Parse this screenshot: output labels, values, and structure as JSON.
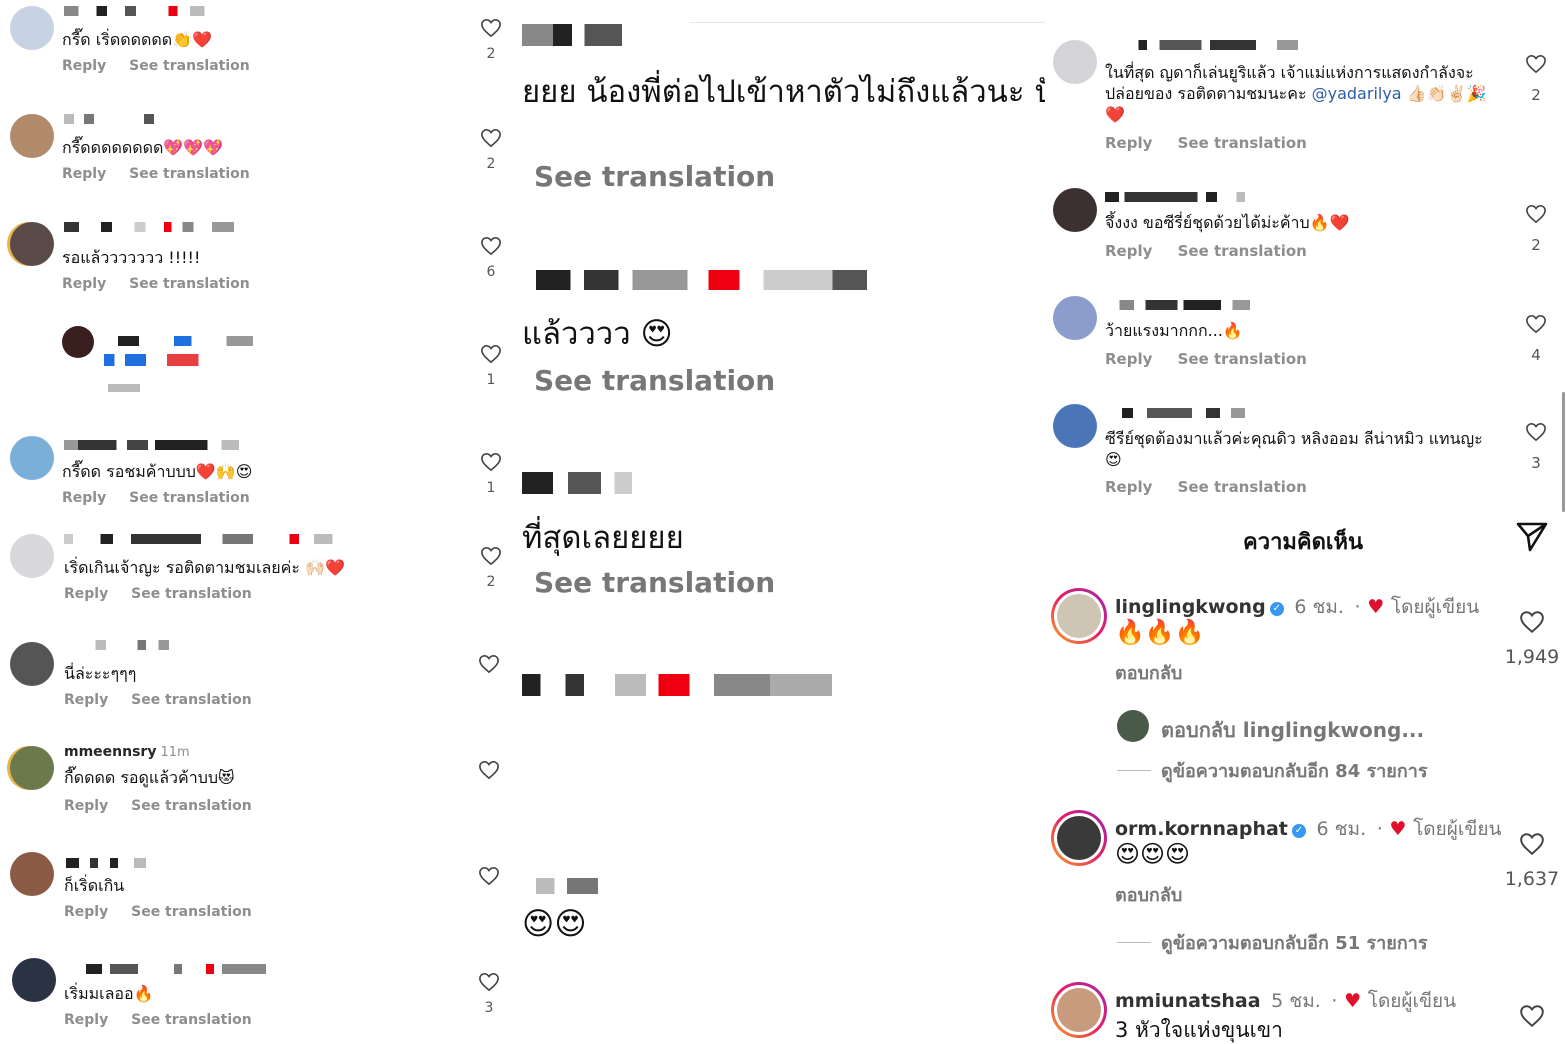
{
  "col1": {
    "comments": [
      {
        "text": "กรี๊ด เริ่ดดดดดด👏❤️",
        "reply": "Reply",
        "translate": "See translation",
        "likes": "2"
      },
      {
        "text": "กรี๊ดดดดดดดด💖💖💖",
        "reply": "Reply",
        "translate": "See translation",
        "likes": "2"
      },
      {
        "text": "รอแล้ววววววว !!!!!",
        "reply": "Reply",
        "translate": "See translation",
        "likes": "6"
      },
      {
        "text": "",
        "reply": "",
        "translate": "",
        "likes": "1"
      },
      {
        "text": "กรี๊ดด รอชมค้าบบบ❤️🙌😍",
        "reply": "Reply",
        "translate": "See translation",
        "likes": "1"
      },
      {
        "text": "เริ่ดเกินเจ้าญะ รอติดตามชมเลยค่ะ 🙌🏻❤️",
        "reply": "Reply",
        "translate": "See translation",
        "likes": "2"
      },
      {
        "text": "นี่ล่ะะะๆๆๆ",
        "reply": "Reply",
        "translate": "See translation",
        "likes": ""
      },
      {
        "username": "mmeennsry",
        "time": "11m",
        "text": "กี๊ดดดด รอดูแล้วค้าบบ😻",
        "reply": "Reply",
        "translate": "See translation",
        "likes": ""
      },
      {
        "text": "ก็เริ่ดเกิน",
        "reply": "Reply",
        "translate": "See translation",
        "likes": ""
      },
      {
        "text": "เริ่มมเลออ🔥",
        "reply": "Reply",
        "translate": "See translation",
        "likes": "3"
      }
    ]
  },
  "col2": {
    "lines": [
      "ยยย น้องพี่ต่อไปเข้าหาตัวไม่ถึงแล้วนะ ปั",
      "แล้วววว 😍",
      "ที่สุดเลยยยย",
      "😍😍"
    ],
    "translate": "See translation"
  },
  "col3": {
    "comments": [
      {
        "text": "ในที่สุด ญดาก็เล่นยูริแล้ว เจ้าแม่แห่งการแสดงกำลังจะปล่อยของ รอติดตามชมนะคะ ",
        "mention": "@yadarilya",
        "tail": " 👍🏻👏🏻✌🏻🎉❤️",
        "reply": "Reply",
        "translate": "See translation",
        "likes": "2"
      },
      {
        "text": "จึ้งงง ขอซีรี่ย์ชุดด้วยได้ม่ะค้าบ🔥❤️",
        "reply": "Reply",
        "translate": "See translation",
        "likes": "2"
      },
      {
        "text": "ว้ายแรงมากกก...🔥",
        "reply": "Reply",
        "translate": "See translation",
        "likes": "4"
      },
      {
        "text": "ซีรีย์ชุดต้องมาแล้วค่ะคุณดิว หลิงออม ลีน่าหมิว แทนญะ 😍",
        "reply": "Reply",
        "translate": "See translation",
        "likes": "3"
      }
    ],
    "header": "ความคิดเห็น",
    "big_comments": [
      {
        "username": "linglingkwong",
        "ago": "6 ชม.",
        "by_author": "โดยผู้เขียน",
        "body": "🔥🔥🔥",
        "reply": "ตอบกลับ",
        "likes": "1,949",
        "subreply": "ตอบกลับ linglingkwong...",
        "viewmore": "ดูข้อความตอบกลับอีก 84 รายการ"
      },
      {
        "username": "orm.kornnaphat",
        "ago": "6 ชม.",
        "by_author": "โดยผู้เขียน",
        "body": "😍😍😍",
        "reply": "ตอบกลับ",
        "likes": "1,637",
        "viewmore": "ดูข้อความตอบกลับอีก 51 รายการ"
      },
      {
        "username": "mmiunatshaa",
        "ago": "5 ชม.",
        "by_author": "โดยผู้เขียน",
        "body": "3 หัวใจแห่งขุนเขา"
      }
    ]
  },
  "colors": {
    "verified": "#3897f0",
    "heart_red": "#e0102c",
    "mention": "#2b5ea8",
    "muted": "#8e8e8e"
  }
}
